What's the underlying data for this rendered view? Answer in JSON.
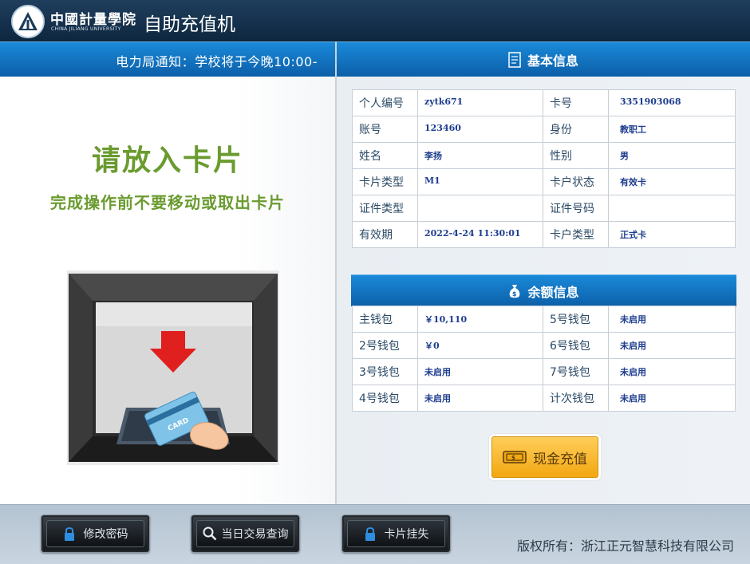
{
  "header": {
    "logo_cn": "中國計量學院",
    "logo_en": "CHINA JILIANG UNIVERSITY",
    "app_title": "自助充值机"
  },
  "left": {
    "notice": "电力局通知：学校将于今晚10:00-",
    "insert_title": "请放入卡片",
    "insert_sub": "完成操作前不要移动或取出卡片",
    "card_text": "CARD"
  },
  "basic_info": {
    "title": "基本信息",
    "rows": [
      {
        "l1": "个人编号",
        "v1": "zytk671",
        "l2": "卡号",
        "v2": "3351903068"
      },
      {
        "l1": "账号",
        "v1": "123460",
        "l2": "身份",
        "v2": "教职工"
      },
      {
        "l1": "姓名",
        "v1": "李扬",
        "l2": "性别",
        "v2": "男"
      },
      {
        "l1": "卡片类型",
        "v1": "M1",
        "l2": "卡户状态",
        "v2": "有效卡"
      },
      {
        "l1": "证件类型",
        "v1": "",
        "l2": "证件号码",
        "v2": ""
      },
      {
        "l1": "有效期",
        "v1": "2022-4-24 11:30:01",
        "l2": "卡户类型",
        "v2": "正式卡"
      }
    ]
  },
  "balance_info": {
    "title": "余额信息",
    "rows": [
      {
        "l1": "主钱包",
        "v1": "￥10,110",
        "l2": "5号钱包",
        "v2": "未启用"
      },
      {
        "l1": "2号钱包",
        "v1": "￥0",
        "l2": "6号钱包",
        "v2": "未启用"
      },
      {
        "l1": "3号钱包",
        "v1": "未启用",
        "l2": "7号钱包",
        "v2": "未启用"
      },
      {
        "l1": "4号钱包",
        "v1": "未启用",
        "l2": "计次钱包",
        "v2": "未启用"
      }
    ]
  },
  "actions": {
    "cash_recharge": "现金充值",
    "change_password": "修改密码",
    "daily_query": "当日交易查询",
    "report_loss": "卡片挂失"
  },
  "footer": {
    "copyright": "版权所有：浙江正元智慧科技有限公司"
  },
  "colors": {
    "title_bg": "#16324f",
    "section_blue": "#1479c4",
    "insert_green": "#6a9b2f",
    "cash_button": "#f6b42a",
    "value_blue": "#1e3d8f"
  }
}
